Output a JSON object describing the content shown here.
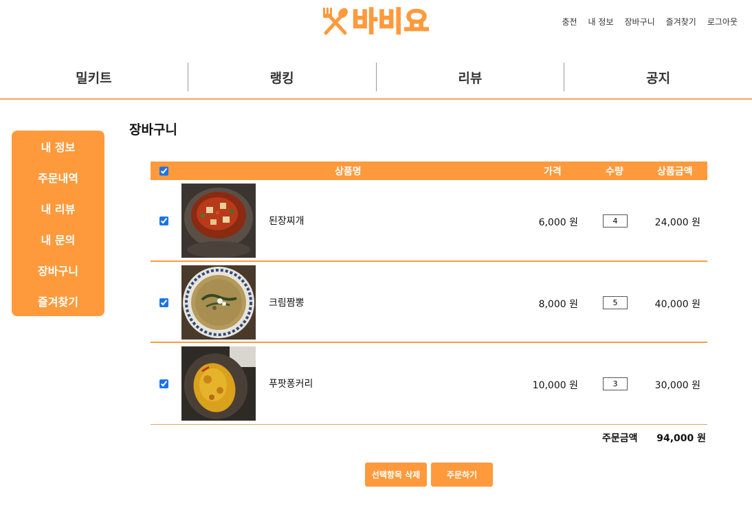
{
  "header": {
    "logo_text": "바비요",
    "top_links": [
      "충전",
      "내 정보",
      "장바구니",
      "즐겨찾기",
      "로그아웃"
    ]
  },
  "nav": [
    "밀키트",
    "랭킹",
    "리뷰",
    "공지"
  ],
  "sidebar": [
    "내 정보",
    "주문내역",
    "내 리뷰",
    "내 문의",
    "장바구니",
    "즐겨찾기"
  ],
  "page_title": "장바구니",
  "cart": {
    "columns": {
      "name": "상품명",
      "price": "가격",
      "qty": "수량",
      "subtotal": "상품금액"
    },
    "items": [
      {
        "name": "된장찌개",
        "price": "6,000 원",
        "qty": "4",
        "subtotal": "24,000 원",
        "checked": true
      },
      {
        "name": "크림짬뽕",
        "price": "8,000 원",
        "qty": "5",
        "subtotal": "40,000 원",
        "checked": true
      },
      {
        "name": "푸팟퐁커리",
        "price": "10,000 원",
        "qty": "3",
        "subtotal": "30,000 원",
        "checked": true
      }
    ],
    "total_label": "주문금액",
    "total_value": "94,000 원"
  },
  "buttons": {
    "delete_selected": "선택항목 삭제",
    "order": "주문하기"
  },
  "colors": {
    "accent": "#ff9a3c",
    "divider": "#f3a35b"
  }
}
